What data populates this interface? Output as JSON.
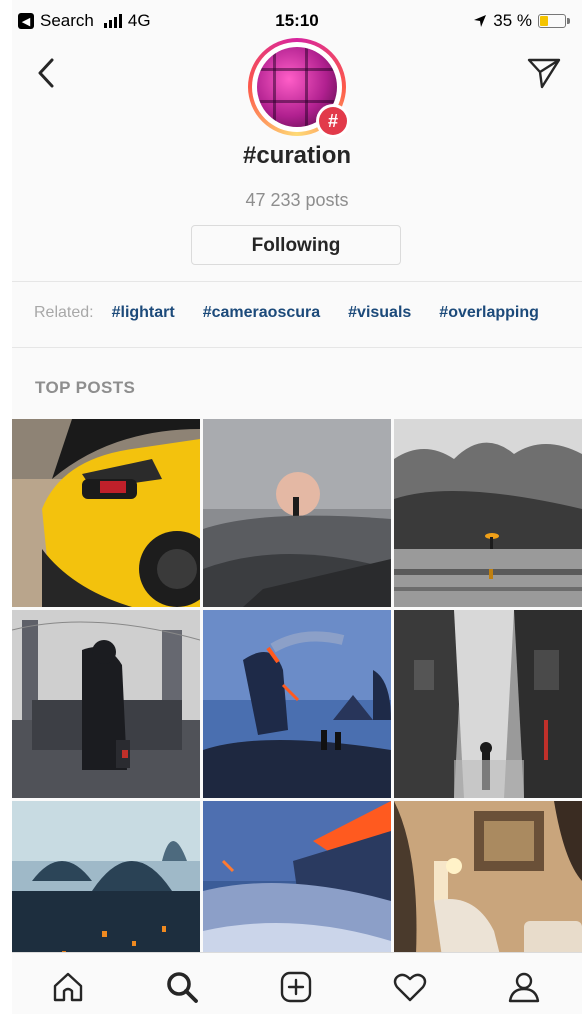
{
  "status_bar": {
    "back_app": "Search",
    "network": "4G",
    "time": "15:10",
    "battery": "35 %",
    "battery_level": 0.35
  },
  "header": {
    "hashtag": "#curation",
    "posts_count": "47 233 posts",
    "follow_button_label": "Following",
    "badge_symbol": "#"
  },
  "related": {
    "label": "Related:",
    "tags": [
      "#lightart",
      "#cameraoscura",
      "#visuals",
      "#overlapping"
    ]
  },
  "section": {
    "title": "TOP POSTS"
  },
  "tab_bar": {
    "items": [
      "home-icon",
      "search-icon",
      "add-post-icon",
      "activity-heart-icon",
      "profile-icon"
    ],
    "active": "search-icon"
  },
  "colors": {
    "link_blue": "#1c4a7a",
    "secondary_text": "#8e8e8e",
    "hashtag_badge": "#e23a4a",
    "battery_fill": "#f5c400"
  }
}
